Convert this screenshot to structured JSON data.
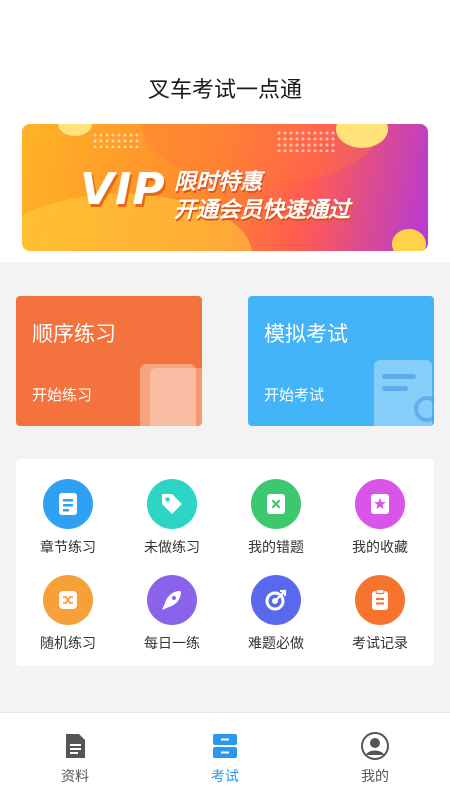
{
  "app": {
    "title": "叉车考试一点通"
  },
  "banner": {
    "badge": "VIP",
    "line1": "限时特惠",
    "line2": "开通会员快速通过"
  },
  "cards": [
    {
      "title": "顺序练习",
      "sub": "开始练习",
      "color": "#f4723d"
    },
    {
      "title": "模拟考试",
      "sub": "开始考试",
      "color": "#44b4f8"
    }
  ],
  "features": [
    {
      "label": "章节练习",
      "icon": "chapter-icon",
      "color": "#2ea1f4"
    },
    {
      "label": "未做练习",
      "icon": "tag-icon",
      "color": "#2cd4c4"
    },
    {
      "label": "我的错题",
      "icon": "error-book-icon",
      "color": "#3dc86f"
    },
    {
      "label": "我的收藏",
      "icon": "favorite-icon",
      "color": "#d954e8"
    },
    {
      "label": "随机练习",
      "icon": "shuffle-icon",
      "color": "#f7a03a"
    },
    {
      "label": "每日一练",
      "icon": "rocket-icon",
      "color": "#8a63ea"
    },
    {
      "label": "难题必做",
      "icon": "target-icon",
      "color": "#5a68ee"
    },
    {
      "label": "考试记录",
      "icon": "clipboard-icon",
      "color": "#f7742f"
    }
  ],
  "tabs": [
    {
      "label": "资料",
      "icon": "document-icon",
      "active": false
    },
    {
      "label": "考试",
      "icon": "exam-icon",
      "active": true
    },
    {
      "label": "我的",
      "icon": "profile-icon",
      "active": false
    }
  ],
  "colors": {
    "accent": "#2a98f0",
    "background": "#f3f3f3"
  }
}
